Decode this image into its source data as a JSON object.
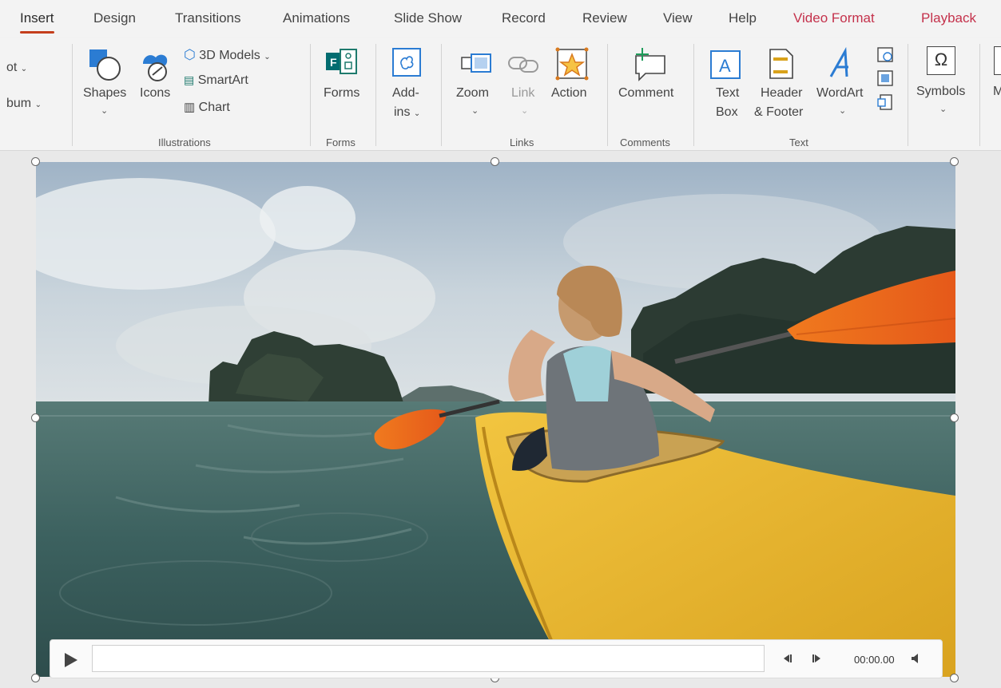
{
  "tabs": [
    {
      "label": "Insert",
      "active": true
    },
    {
      "label": "Design"
    },
    {
      "label": "Transitions"
    },
    {
      "label": "Animations"
    },
    {
      "label": "Slide Show"
    },
    {
      "label": "Record"
    },
    {
      "label": "Review"
    },
    {
      "label": "View"
    },
    {
      "label": "Help"
    },
    {
      "label": "Video Format",
      "contextual": true
    },
    {
      "label": "Playback",
      "contextual": true
    }
  ],
  "ribbon": {
    "partial_top": "ot",
    "partial_bottom": "bum",
    "illustrations": {
      "shapes": "Shapes",
      "icons": "Icons",
      "models3d": "3D Models",
      "smartart": "SmartArt",
      "chart": "Chart",
      "group": "Illustrations"
    },
    "forms": {
      "label": "Forms",
      "group": "Forms"
    },
    "addins": {
      "line1": "Add-",
      "line2": "ins"
    },
    "links": {
      "zoom": "Zoom",
      "link": "Link",
      "action": "Action",
      "group": "Links"
    },
    "comments": {
      "comment": "Comment",
      "group": "Comments"
    },
    "text": {
      "textbox1": "Text",
      "textbox2": "Box",
      "header1": "Header",
      "header2": "& Footer",
      "wordart": "WordArt",
      "group": "Text"
    },
    "symbols": {
      "label": "Symbols",
      "symbol_glyph": "Ω"
    },
    "partial_right": "M"
  },
  "player": {
    "time": "00:00.00",
    "progress": 0
  },
  "colors": {
    "accent": "#c43e1c",
    "contextual_tab": "#c4314b",
    "icon_blue": "#2b7cd3",
    "icon_teal": "#1e7a6d",
    "kayak": "#e8b830",
    "paddle": "#e7651b"
  }
}
